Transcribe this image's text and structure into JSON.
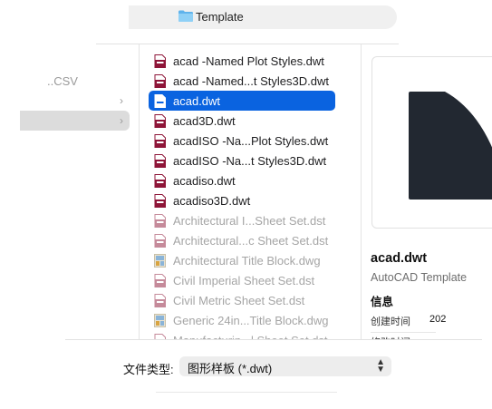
{
  "toolbar": {
    "folder_name": "Template",
    "folder_icon": "folder-icon"
  },
  "sidebar": {
    "partial_item": "..CSV"
  },
  "files": [
    {
      "name": "acad -Named Plot Styles.dwt",
      "icon": "dwt-file-icon",
      "state": "normal"
    },
    {
      "name": "acad -Named...t Styles3D.dwt",
      "icon": "dwt-file-icon",
      "state": "normal"
    },
    {
      "name": "acad.dwt",
      "icon": "dwt-file-icon",
      "state": "selected"
    },
    {
      "name": "acad3D.dwt",
      "icon": "dwt-file-icon",
      "state": "normal"
    },
    {
      "name": "acadISO -Na...Plot Styles.dwt",
      "icon": "dwt-file-icon",
      "state": "normal"
    },
    {
      "name": "acadISO -Na...t Styles3D.dwt",
      "icon": "dwt-file-icon",
      "state": "normal"
    },
    {
      "name": "acadiso.dwt",
      "icon": "dwt-file-icon",
      "state": "normal"
    },
    {
      "name": "acadiso3D.dwt",
      "icon": "dwt-file-icon",
      "state": "normal"
    },
    {
      "name": "Architectural I...Sheet Set.dst",
      "icon": "dst-file-icon",
      "state": "disabled"
    },
    {
      "name": "Architectural...c Sheet Set.dst",
      "icon": "dst-file-icon",
      "state": "disabled"
    },
    {
      "name": "Architectural Title Block.dwg",
      "icon": "dwg-file-icon",
      "state": "disabled"
    },
    {
      "name": "Civil Imperial Sheet Set.dst",
      "icon": "dst-file-icon",
      "state": "disabled"
    },
    {
      "name": "Civil Metric Sheet Set.dst",
      "icon": "dst-file-icon",
      "state": "disabled"
    },
    {
      "name": "Generic 24in...Title Block.dwg",
      "icon": "dwg-file-icon",
      "state": "disabled"
    },
    {
      "name": "Manufacturin...l Sheet Set.dst",
      "icon": "dst-file-icon",
      "state": "disabled"
    }
  ],
  "preview": {
    "file_name": "acad.dwt",
    "file_kind": "AutoCAD Template",
    "info_heading": "信息",
    "created_label": "创建时间",
    "created_value": "202",
    "modified_label": "修改时间"
  },
  "format": {
    "label": "文件类型:",
    "selected": "图形样板 (*.dwt)"
  },
  "colors": {
    "selection": "#0a63e0",
    "dwt_icon": "#8e1538",
    "preview_shape": "#222831"
  }
}
